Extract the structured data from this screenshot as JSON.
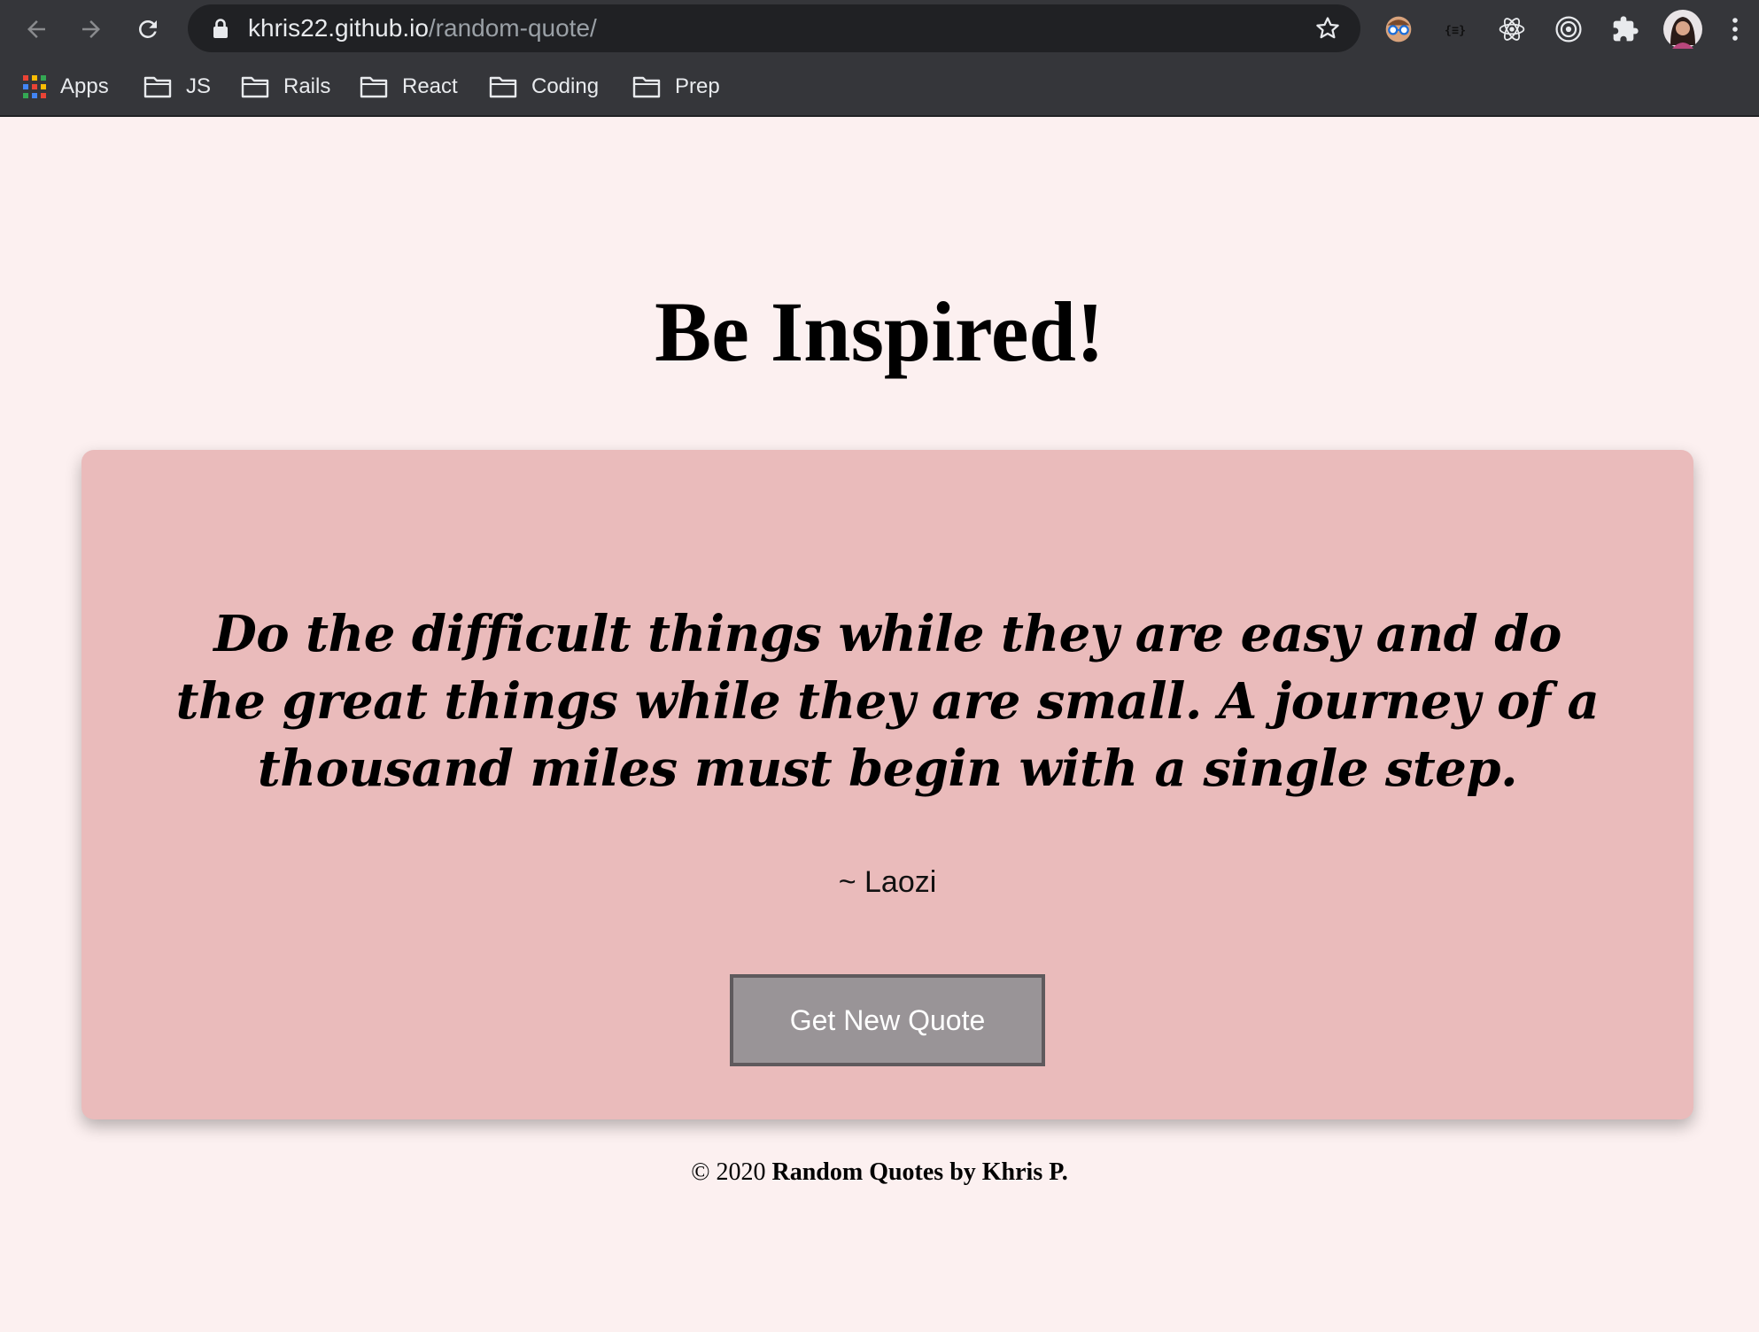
{
  "browser": {
    "url_host": "khris22.github.io",
    "url_path": "/random-quote/",
    "bookmarks": [
      {
        "label": "Apps",
        "icon": "apps-grid-icon"
      },
      {
        "label": "JS",
        "icon": "folder-icon"
      },
      {
        "label": "Rails",
        "icon": "folder-icon"
      },
      {
        "label": "React",
        "icon": "folder-icon"
      },
      {
        "label": "Coding",
        "icon": "folder-icon"
      },
      {
        "label": "Prep",
        "icon": "folder-icon"
      }
    ],
    "extensions": [
      "glasses-extension-icon",
      "json-extension-icon",
      "react-devtools-icon",
      "target-extension-icon",
      "puzzle-extensions-icon",
      "profile-avatar-icon",
      "menu-kebab-icon"
    ]
  },
  "page": {
    "title": "Be Inspired!",
    "quote": "Do the difficult things while they are easy and do the great things while they are small. A journey of a thousand miles must begin with a single step.",
    "author": "~ Laozi",
    "button_label": "Get New Quote",
    "footer_prefix": "© 2020",
    "footer_bold": "Random Quotes by Khris P."
  },
  "colors": {
    "page_bg": "#fcf0f0",
    "card_bg": "#eabbbb",
    "button_bg": "#999497",
    "button_border": "#5f5a5d"
  }
}
